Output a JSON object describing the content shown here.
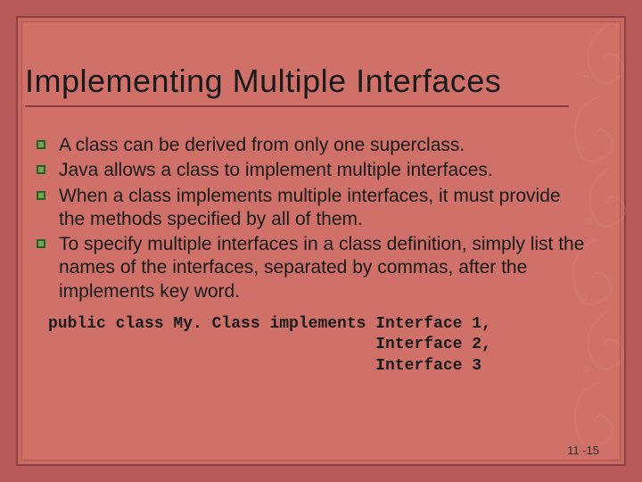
{
  "title": "Implementing Multiple Interfaces",
  "bullets": [
    "A class can be derived from only one superclass.",
    "Java allows a class to implement multiple interfaces.",
    "When a class implements multiple interfaces, it must provide the methods specified by all of them.",
    "To specify multiple interfaces in a class definition, simply list the names of the interfaces, separated by commas, after the implements key word."
  ],
  "code": "public class My. Class implements Interface 1,\n                                  Interface 2,\n                                  Interface 3",
  "page_number": "11 -15",
  "bullet_icon_name": "green-square-bullet-icon"
}
